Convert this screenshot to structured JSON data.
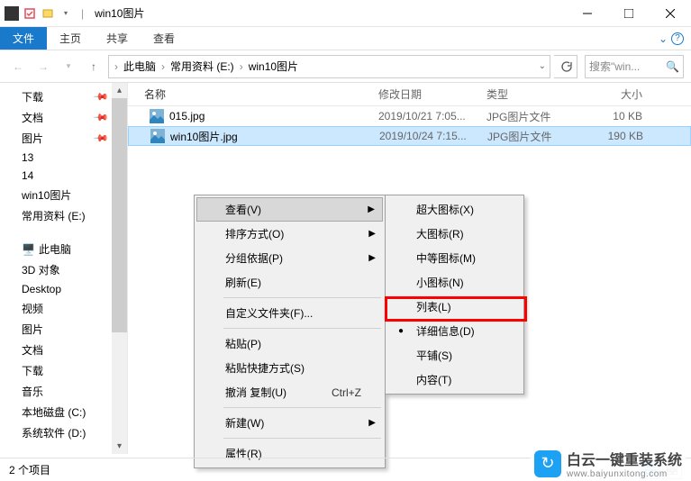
{
  "title": "win10图片",
  "ribbon": {
    "tabs": [
      "文件",
      "主页",
      "共享",
      "查看"
    ]
  },
  "breadcrumb": {
    "root": "此电脑",
    "parts": [
      "常用资料 (E:)",
      "win10图片"
    ]
  },
  "search": {
    "placeholder": "搜索\"win..."
  },
  "sidebar": {
    "items1": [
      {
        "label": "下载",
        "pin": true
      },
      {
        "label": "文档",
        "pin": true
      },
      {
        "label": "图片",
        "pin": true
      },
      {
        "label": "13"
      },
      {
        "label": "14"
      },
      {
        "label": "win10图片"
      },
      {
        "label": "常用资料 (E:)"
      }
    ],
    "pc": "此电脑",
    "items2": [
      {
        "label": "3D 对象"
      },
      {
        "label": "Desktop"
      },
      {
        "label": "视频"
      },
      {
        "label": "图片"
      },
      {
        "label": "文档"
      },
      {
        "label": "下载"
      },
      {
        "label": "音乐"
      },
      {
        "label": "本地磁盘 (C:)"
      },
      {
        "label": "系统软件 (D:)"
      }
    ]
  },
  "columns": {
    "name": "名称",
    "date": "修改日期",
    "type": "类型",
    "size": "大小"
  },
  "files": [
    {
      "name": "015.jpg",
      "date": "2019/10/21 7:05...",
      "type": "JPG图片文件",
      "size": "10 KB"
    },
    {
      "name": "win10图片.jpg",
      "date": "2019/10/24 7:15...",
      "type": "JPG图片文件",
      "size": "190 KB"
    }
  ],
  "menu1": [
    {
      "label": "查看(V)",
      "arrow": true,
      "hover": true
    },
    {
      "label": "排序方式(O)",
      "arrow": true
    },
    {
      "label": "分组依据(P)",
      "arrow": true
    },
    {
      "label": "刷新(E)"
    },
    {
      "sep": true
    },
    {
      "label": "自定义文件夹(F)..."
    },
    {
      "sep": true
    },
    {
      "label": "粘贴(P)"
    },
    {
      "label": "粘贴快捷方式(S)"
    },
    {
      "label": "撤消 复制(U)",
      "shortcut": "Ctrl+Z"
    },
    {
      "sep": true
    },
    {
      "label": "新建(W)",
      "arrow": true
    },
    {
      "sep": true
    },
    {
      "label": "属性(R)"
    }
  ],
  "menu2": [
    {
      "label": "超大图标(X)"
    },
    {
      "label": "大图标(R)"
    },
    {
      "label": "中等图标(M)"
    },
    {
      "label": "小图标(N)"
    },
    {
      "label": "列表(L)"
    },
    {
      "label": "详细信息(D)",
      "bullet": true
    },
    {
      "label": "平铺(S)"
    },
    {
      "label": "内容(T)"
    }
  ],
  "status": "2 个项目",
  "watermark": {
    "text": "白云一键重装系统",
    "url": "www.baiyunxitong.com"
  }
}
